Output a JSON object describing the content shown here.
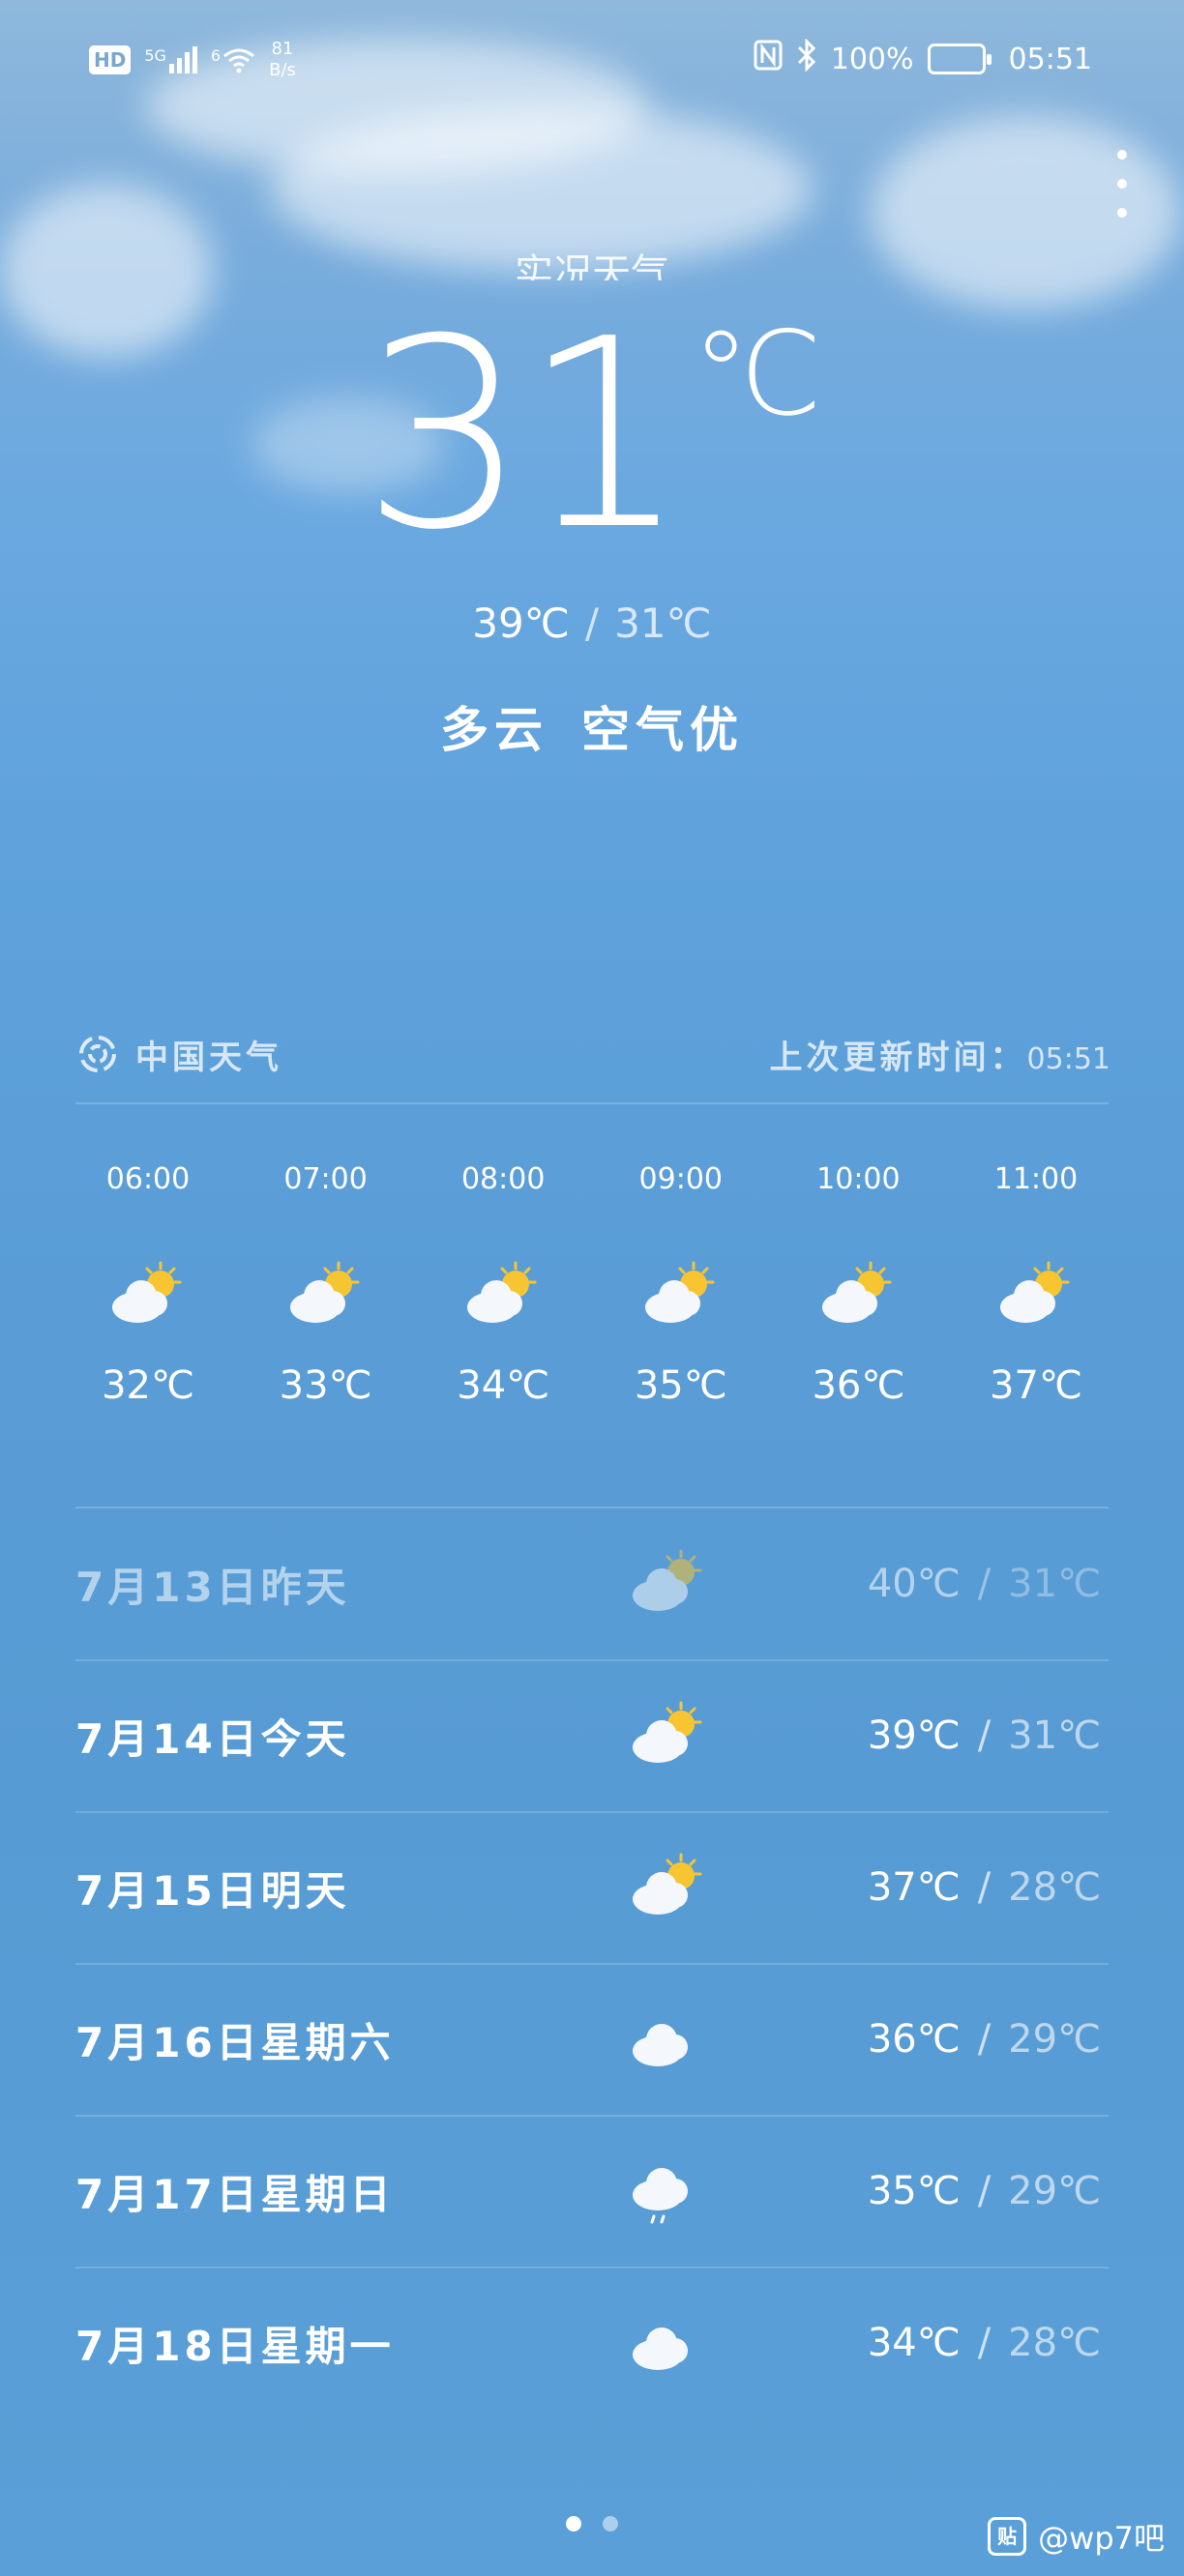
{
  "status_bar": {
    "hd": "HD",
    "sig1": "5G",
    "sig2": "6",
    "speed_value": "81",
    "speed_unit": "B/s",
    "battery": "100%",
    "time": "05:51"
  },
  "location": "实况天气",
  "current": {
    "temp": "31",
    "unit": "℃",
    "high": "39℃",
    "sep": "/",
    "low": "31℃",
    "condition": "多云",
    "air": "空气优"
  },
  "source": {
    "name": "中国天气",
    "update_label": "上次更新时间：",
    "update_time": "05:51"
  },
  "hourly": [
    {
      "time": "06:00",
      "temp": "32℃",
      "icon": "partly-cloudy-icon"
    },
    {
      "time": "07:00",
      "temp": "33℃",
      "icon": "partly-cloudy-icon"
    },
    {
      "time": "08:00",
      "temp": "34℃",
      "icon": "partly-cloudy-icon"
    },
    {
      "time": "09:00",
      "temp": "35℃",
      "icon": "partly-cloudy-icon"
    },
    {
      "time": "10:00",
      "temp": "36℃",
      "icon": "partly-cloudy-icon"
    },
    {
      "time": "11:00",
      "temp": "37℃",
      "icon": "partly-cloudy-icon"
    }
  ],
  "daily": [
    {
      "label": "7月13日昨天",
      "high": "40℃",
      "low": "31℃",
      "icon": "partly-cloudy-icon",
      "sep": "/"
    },
    {
      "label": "7月14日今天",
      "high": "39℃",
      "low": "31℃",
      "icon": "partly-cloudy-icon",
      "sep": "/"
    },
    {
      "label": "7月15日明天",
      "high": "37℃",
      "low": "28℃",
      "icon": "partly-cloudy-icon",
      "sep": "/"
    },
    {
      "label": "7月16日星期六",
      "high": "36℃",
      "low": "29℃",
      "icon": "cloudy-icon",
      "sep": "/"
    },
    {
      "label": "7月17日星期日",
      "high": "35℃",
      "low": "29℃",
      "icon": "light-rain-icon",
      "sep": "/"
    },
    {
      "label": "7月18日星期一",
      "high": "34℃",
      "low": "28℃",
      "icon": "cloudy-icon",
      "sep": "/"
    }
  ],
  "watermark": {
    "icon_text": "贴",
    "text": "@wp7吧"
  },
  "colors": {
    "sky_top": "#8fb8dc",
    "sky_bottom": "#5a9fd7",
    "sun": "#f7c531",
    "cloud": "#f4f7fb"
  }
}
